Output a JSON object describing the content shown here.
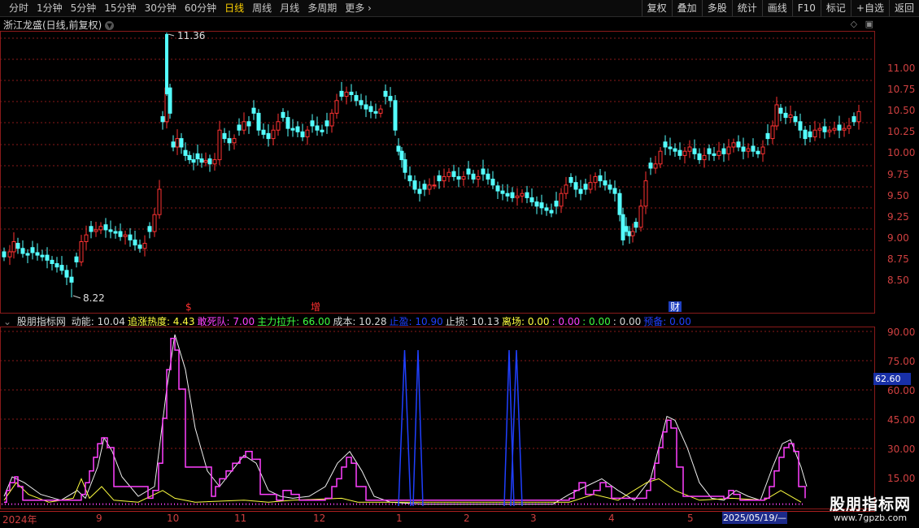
{
  "toolbar": {
    "periods": [
      "分时",
      "1分钟",
      "5分钟",
      "15分钟",
      "30分钟",
      "60分钟",
      "日线",
      "周线",
      "月线",
      "多周期",
      "更多 ›"
    ],
    "active_period": "日线",
    "tools": [
      "复权",
      "叠加",
      "多股",
      "统计",
      "画线",
      "F10",
      "标记",
      "+自选",
      "返回"
    ]
  },
  "stock": {
    "title": "浙江龙盛(日线,前复权)"
  },
  "price_axis": {
    "labels": [
      "11.00",
      "10.75",
      "10.50",
      "10.25",
      "10.00",
      "9.75",
      "9.50",
      "9.25",
      "9.00",
      "8.75",
      "8.50"
    ]
  },
  "annotations": {
    "high": "11.36",
    "low": "8.22",
    "marks": [
      "$",
      "增",
      "财"
    ]
  },
  "indicator": {
    "name": "股朋指标网",
    "items": [
      {
        "k": "动能:",
        "v": "10.04",
        "color": "#d8d8d8"
      },
      {
        "k": "追涨热度:",
        "v": "4.43",
        "color": "#ffff40"
      },
      {
        "k": "敢死队:",
        "v": "7.00",
        "color": "#ff40ff"
      },
      {
        "k": "主力拉升:",
        "v": "66.00",
        "color": "#40ff40"
      },
      {
        "k": "成本:",
        "v": "10.28",
        "color": "#d8d8d8"
      },
      {
        "k": "止盈:",
        "v": "10.90",
        "color": "#2040ff"
      },
      {
        "k": "止损:",
        "v": "10.13",
        "color": "#d8d8d8"
      },
      {
        "k": "离场:",
        "v": "0.00",
        "color": "#ffff40"
      },
      {
        "k": ":",
        "v": "0.00",
        "color": "#ff40ff"
      },
      {
        "k": ":",
        "v": "0.00",
        "color": "#40ff40"
      },
      {
        "k": ":",
        "v": "0.00",
        "color": "#d8d8d8"
      },
      {
        "k": "预备:",
        "v": "0.00",
        "color": "#2040ff"
      }
    ],
    "axis_labels": [
      "90.00",
      "75.00",
      "60.00",
      "45.00",
      "30.00",
      "15.00"
    ],
    "current_value": "62.60"
  },
  "date_axis": {
    "labels": [
      "2024年",
      "9",
      "10",
      "11",
      "12",
      "1",
      "2",
      "3",
      "4",
      "5"
    ],
    "cursor_date": "2025/05/19/—"
  },
  "watermark": {
    "name": "股朋指标网",
    "url": "www.7gpzb.com"
  },
  "colors": {
    "up": "#ff3232",
    "down": "#54ffff",
    "grid": "#8a1a1a"
  }
}
